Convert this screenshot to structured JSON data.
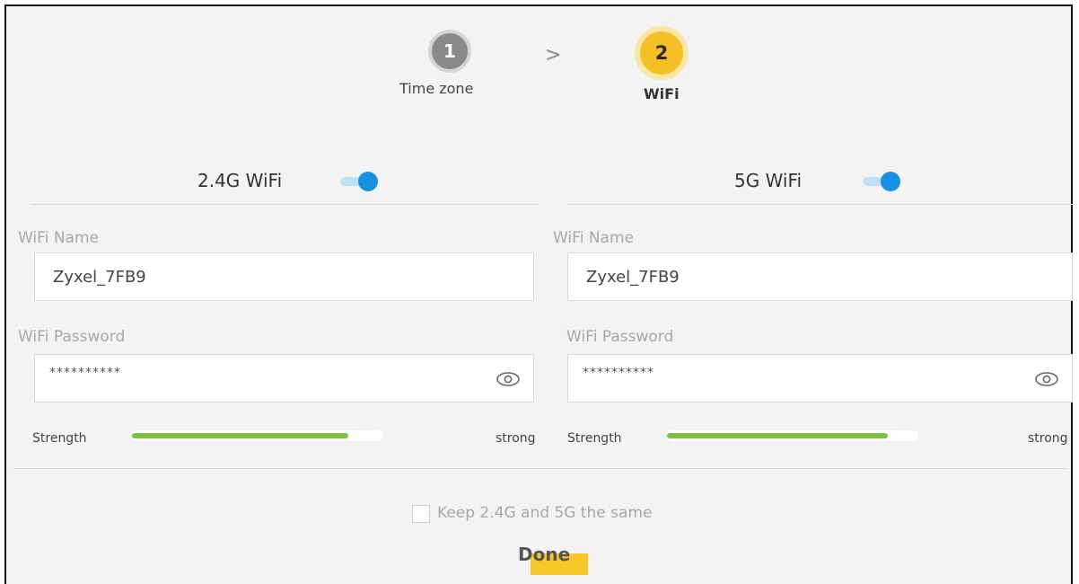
{
  "steps": [
    {
      "number": "1",
      "label": "Time zone"
    },
    {
      "number": "2",
      "label": "WiFi"
    }
  ],
  "step_separator": ">",
  "band_24": {
    "title": "2.4G WiFi",
    "enabled": true,
    "name_label": "WiFi Name",
    "name_value": "Zyxel_7FB9",
    "password_label": "WiFi Password",
    "password_value": "**********",
    "strength_label": "Strength",
    "strength_text": "strong",
    "strength_fill": 0.86
  },
  "band_5": {
    "title": "5G WiFi",
    "enabled": true,
    "name_label": "WiFi Name",
    "name_value": "Zyxel_7FB9",
    "password_label": "WiFi Password",
    "password_value": "**********",
    "strength_label": "Strength",
    "strength_text": "strong",
    "strength_fill": 0.88
  },
  "keep_same": {
    "label": "Keep 2.4G and 5G the same",
    "checked": false
  },
  "done_label": "Done",
  "colors": {
    "accent": "#f4c025",
    "toggle": "#1a8fe3",
    "strength": "#7cc339"
  }
}
